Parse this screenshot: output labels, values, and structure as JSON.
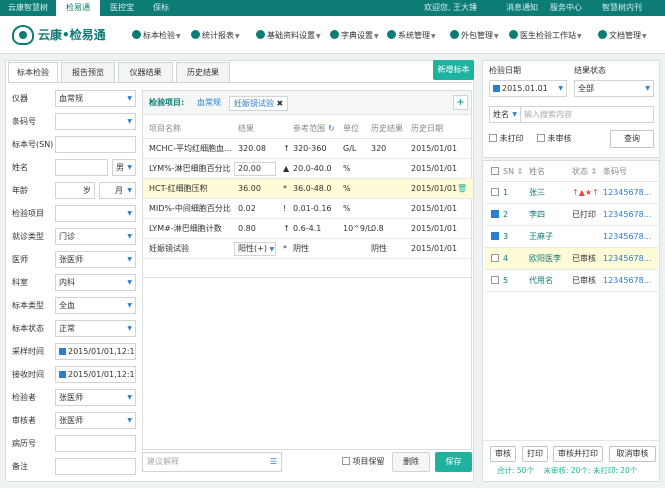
{
  "topbar": {
    "tabs": [
      "云康智慧树",
      "检易通",
      "医控宝",
      "保标"
    ],
    "welcome": "欢迎您, 王大锤",
    "links": [
      "消息通知",
      "服务中心",
      "智慧树内刊"
    ]
  },
  "header": {
    "logo": "云康•检易通",
    "menu": [
      "标本检验",
      "统计报表",
      "基础资料设置",
      "字典设置",
      "系统管理",
      "外包管理",
      "医生检验工作站",
      "文档管理"
    ]
  },
  "left": {
    "tabs": [
      "标本检验",
      "报告预览",
      "仪器结果",
      "历史结果"
    ],
    "new_btn": "新增标本",
    "form": [
      {
        "label": "仪器",
        "value": "血常规"
      },
      {
        "label": "条码号",
        "value": ""
      },
      {
        "label": "标本号(SN)",
        "value": ""
      },
      {
        "label": "姓名",
        "value": "",
        "extra": "男"
      },
      {
        "label": "年龄",
        "value": "岁",
        "extra": "月"
      },
      {
        "label": "检验项目",
        "value": ""
      },
      {
        "label": "就诊类型",
        "value": "门诊"
      },
      {
        "label": "医师",
        "value": "张医师"
      },
      {
        "label": "科室",
        "value": "内科"
      },
      {
        "label": "标本类型",
        "value": "全血"
      },
      {
        "label": "标本状态",
        "value": "正常"
      },
      {
        "label": "采样时间",
        "value": "2015/01/01,12:12"
      },
      {
        "label": "接收时间",
        "value": "2015/01/01,12:12"
      },
      {
        "label": "检验者",
        "value": "张医师"
      },
      {
        "label": "审核者",
        "value": "张医师"
      },
      {
        "label": "病历号",
        "value": ""
      },
      {
        "label": "备注",
        "value": ""
      }
    ],
    "items_label": "检验项目:",
    "items": [
      "血常规",
      "妊娠镜试验"
    ],
    "cols": [
      "项目名称",
      "结果",
      "参考范围",
      "单位",
      "历史结果",
      "历史日期"
    ],
    "rows": [
      {
        "name": "MCHC-平均红细胞血...",
        "result": "320.08",
        "flag": "↑",
        "range": "320-360",
        "unit": "G/L",
        "hist": "320",
        "date": "2015/01/01"
      },
      {
        "name": "LYM%-淋巴细胞百分比",
        "result": "20.00",
        "flag": "▲",
        "range": "20.0-40.0",
        "unit": "%",
        "hist": "",
        "date": "2015/01/01"
      },
      {
        "name": "HCT-红细胞压积",
        "result": "36.00",
        "flag": "*",
        "range": "36.0-48.0",
        "unit": "%",
        "hist": "",
        "date": "2015/01/01"
      },
      {
        "name": "MID%-中间细胞百分比",
        "result": "0.02",
        "flag": "!",
        "range": "0.01-0.16",
        "unit": "%",
        "hist": "",
        "date": "2015/01/01"
      },
      {
        "name": "LYM#-淋巴细胞计数",
        "result": "0.80",
        "flag": "↑",
        "range": "0.6-4.1",
        "unit": "10^9/L",
        "hist": "0.8",
        "date": "2015/01/01"
      },
      {
        "name": "妊娠镜试验",
        "result": "阳性(+)",
        "flag": "*",
        "range": "阴性",
        "unit": "",
        "hist": "阴性",
        "date": "2015/01/01"
      }
    ],
    "note_placeholder": "建议解释",
    "keep_label": "项目保留",
    "delete_btn": "删除",
    "save_btn": "保存"
  },
  "right": {
    "date_label": "检验日期",
    "date_value": "2015.01.01",
    "status_label": "结果状态",
    "status_value": "全部",
    "search_field": "姓名",
    "search_placeholder": "输入搜索内容",
    "unprinted": "未打印",
    "unreviewed": "未审核",
    "query_btn": "查询",
    "cols": [
      "SN",
      "姓名",
      "状态",
      "条码号"
    ],
    "rows": [
      {
        "sn": "1",
        "name": "张三",
        "status": "↑▲★↑",
        "code": "12345678...",
        "checked": false
      },
      {
        "sn": "2",
        "name": "李四",
        "status": "已打印",
        "code": "12345678...",
        "checked": true
      },
      {
        "sn": "3",
        "name": "王麻子",
        "status": "",
        "code": "12345678...",
        "checked": true
      },
      {
        "sn": "4",
        "name": "欧阳医李",
        "status": "已审核",
        "code": "12345678...",
        "checked": false
      },
      {
        "sn": "5",
        "name": "代用名",
        "status": "已审核",
        "code": "12345678...",
        "checked": false
      }
    ],
    "buttons": [
      "审核",
      "打印",
      "审核并打印",
      "取消审核"
    ],
    "summary": "合计: 50个    未审核: 20个; 未打印: 20个"
  },
  "colors": {
    "brand": "#0d7c75",
    "accent": "#1fb39f",
    "link": "#2b7fd0"
  }
}
